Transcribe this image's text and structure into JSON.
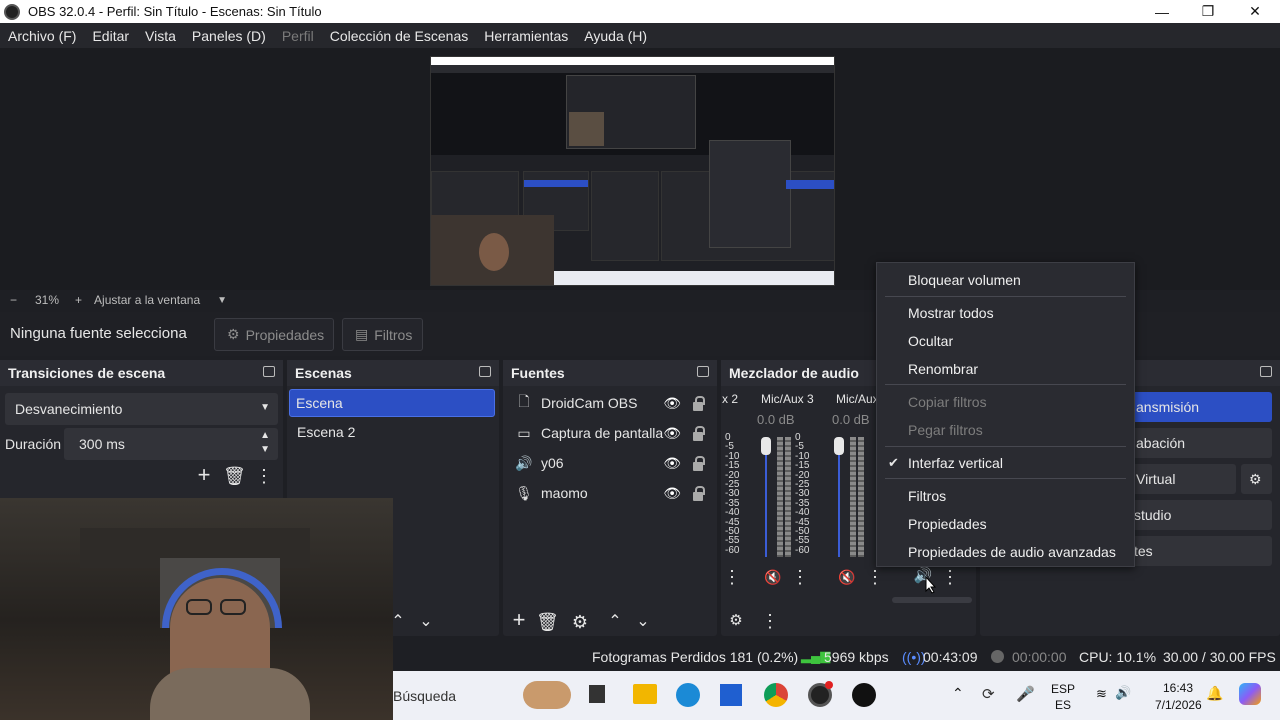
{
  "window": {
    "title": "OBS 32.0.4 - Perfil: Sin Título - Escenas: Sin Título",
    "minimize": "—",
    "maximize": "❐",
    "close": "✕"
  },
  "menu": [
    "Archivo (F)",
    "Editar",
    "Vista",
    "Paneles (D)",
    "Perfil",
    "Colección de Escenas",
    "Herramientas",
    "Ayuda (H)"
  ],
  "zoom": {
    "minus": "−",
    "value": "31%",
    "plus": "+",
    "fit": "Ajustar a la ventana"
  },
  "source_toolbar": {
    "no_source": "Ninguna fuente selecciona",
    "properties": "Propiedades",
    "filters": "Filtros"
  },
  "transitions": {
    "title": "Transiciones de escena",
    "selected": "Desvanecimiento",
    "duration_label": "Duración",
    "duration_value": "300 ms"
  },
  "scenes": {
    "title": "Escenas",
    "items": [
      "Escena",
      "Escena 2"
    ]
  },
  "sources": {
    "title": "Fuentes",
    "items": [
      {
        "label": "DroidCam OBS",
        "icon": "file-icon"
      },
      {
        "label": "Captura de pantalla",
        "icon": "monitor-icon"
      },
      {
        "label": "y06",
        "icon": "speaker-icon"
      },
      {
        "label": "maomo",
        "icon": "microphone-icon"
      }
    ]
  },
  "mixer": {
    "title": "Mezclador de audio",
    "channels": [
      {
        "name": "x 2",
        "db": ""
      },
      {
        "name": "Mic/Aux 3",
        "db": "0.0 dB"
      },
      {
        "name": "Mic/Aux",
        "db": "0.0 dB"
      }
    ],
    "scale": [
      "0",
      "-5",
      "-10",
      "-15",
      "-20",
      "-25",
      "-30",
      "-35",
      "-40",
      "-45",
      "-50",
      "-55",
      "-60"
    ]
  },
  "controls": {
    "stream": "ansmisión",
    "record": "abación",
    "virtual": "Virtual",
    "studio": "studio",
    "settings": "tes"
  },
  "context_menu": {
    "items": [
      {
        "label": "Bloquear volumen",
        "disabled": false
      },
      {
        "label": "Mostrar todos",
        "disabled": false
      },
      {
        "label": "Ocultar",
        "disabled": false
      },
      {
        "label": "Renombrar",
        "disabled": false
      },
      {
        "label": "Copiar filtros",
        "disabled": true
      },
      {
        "label": "Pegar filtros",
        "disabled": true
      },
      {
        "label": "Interfaz vertical",
        "disabled": false,
        "checked": true
      },
      {
        "label": "Filtros",
        "disabled": false
      },
      {
        "label": "Propiedades",
        "disabled": false
      },
      {
        "label": "Propiedades de audio avanzadas",
        "disabled": false
      }
    ]
  },
  "status": {
    "dropped": "Fotogramas Perdidos 181 (0.2%)",
    "bitrate": "5969 kbps",
    "stream_time": "00:43:09",
    "rec_time": "00:00:00",
    "cpu": "CPU: 10.1%",
    "fps": "30.00 / 30.00 FPS"
  },
  "taskbar": {
    "search": "Búsqueda",
    "lang1": "ESP",
    "lang2": "ES",
    "time": "16:43",
    "date": "7/1/2026"
  },
  "colors": {
    "accent": "#2c4fc4",
    "panel": "#25262c",
    "background": "#1e1f24"
  }
}
